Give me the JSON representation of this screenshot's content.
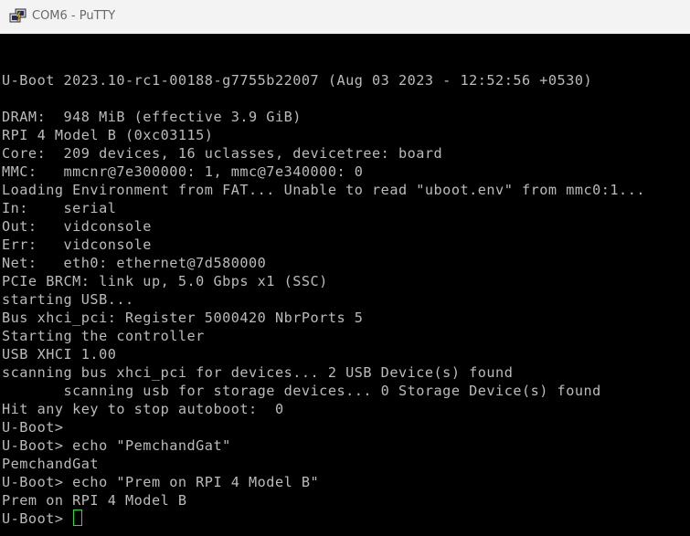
{
  "window": {
    "title": "COM6 - PuTTY",
    "app_icon": "putty-icon"
  },
  "colors": {
    "background": "#000000",
    "text": "#bbbbbb",
    "cursor": "#22e03a",
    "titlebar": "#f3f3f3",
    "title_text": "#6a6a6a"
  },
  "terminal": {
    "lines": [
      "U-Boot 2023.10-rc1-00188-g7755b22007 (Aug 03 2023 - 12:52:56 +0530)",
      "",
      "DRAM:  948 MiB (effective 3.9 GiB)",
      "RPI 4 Model B (0xc03115)",
      "Core:  209 devices, 16 uclasses, devicetree: board",
      "MMC:   mmcnr@7e300000: 1, mmc@7e340000: 0",
      "Loading Environment from FAT... Unable to read \"uboot.env\" from mmc0:1...",
      "In:    serial",
      "Out:   vidconsole",
      "Err:   vidconsole",
      "Net:   eth0: ethernet@7d580000",
      "PCIe BRCM: link up, 5.0 Gbps x1 (SSC)",
      "starting USB...",
      "Bus xhci_pci: Register 5000420 NbrPorts 5",
      "Starting the controller",
      "USB XHCI 1.00",
      "scanning bus xhci_pci for devices... 2 USB Device(s) found",
      "       scanning usb for storage devices... 0 Storage Device(s) found",
      "Hit any key to stop autoboot:  0",
      "U-Boot>",
      "U-Boot> echo \"PemchandGat\"",
      "PemchandGat",
      "U-Boot> echo \"Prem on RPI 4 Model B\"",
      "Prem on RPI 4 Model B",
      "U-Boot> "
    ],
    "cursor_line": 24
  }
}
